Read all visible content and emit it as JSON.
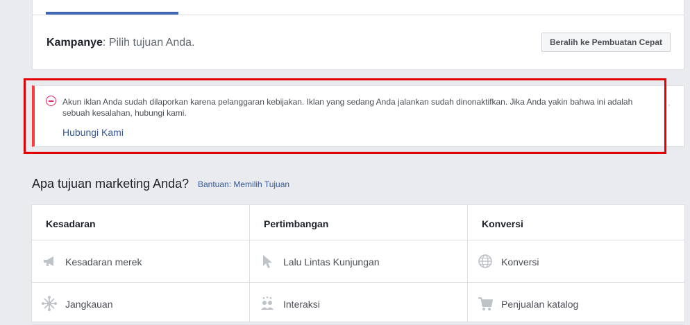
{
  "campaign": {
    "prefix": "Kampanye",
    "subtitle": ": Pilih tujuan Anda.",
    "quick_create_button": "Beralih ke Pembuatan Cepat"
  },
  "warning": {
    "message": "Akun iklan Anda sudah dilaporkan karena pelanggaran kebijakan. Iklan yang sedang Anda jalankan sudah dinonaktifkan. Jika Anda yakin bahwa ini adalah sebuah kesalahan, hubungi kami.",
    "link": "Hubungi Kami",
    "more": "··"
  },
  "objectives": {
    "title": "Apa tujuan marketing Anda?",
    "help_link": "Bantuan: Memilih Tujuan",
    "columns": [
      {
        "header": "Kesadaran",
        "items": [
          {
            "label": "Kesadaran merek",
            "icon": "megaphone-icon"
          },
          {
            "label": "Jangkauan",
            "icon": "reach-icon"
          }
        ]
      },
      {
        "header": "Pertimbangan",
        "items": [
          {
            "label": "Lalu Lintas Kunjungan",
            "icon": "cursor-icon"
          },
          {
            "label": "Interaksi",
            "icon": "people-icon"
          }
        ]
      },
      {
        "header": "Konversi",
        "items": [
          {
            "label": "Konversi",
            "icon": "globe-icon"
          },
          {
            "label": "Penjualan katalog",
            "icon": "cart-icon"
          }
        ]
      }
    ]
  },
  "colors": {
    "accent": "#4267b2",
    "error": "#fa3e3e",
    "highlight": "#e30000",
    "link": "#365899"
  }
}
